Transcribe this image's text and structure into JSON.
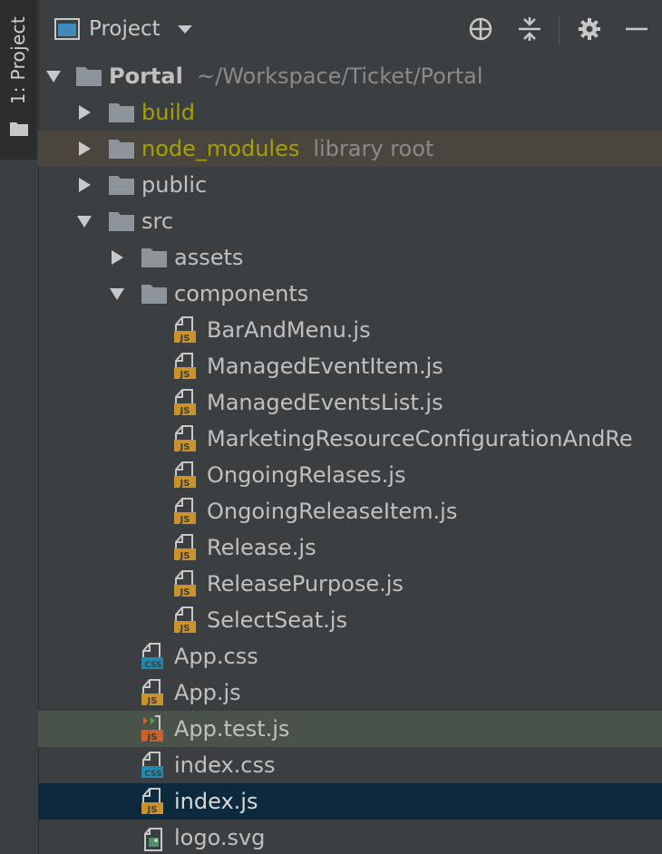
{
  "side_tab": {
    "label": "1: Project"
  },
  "toolbar": {
    "title": "Project"
  },
  "tree": {
    "root": {
      "name": "Portal",
      "path": "~/Workspace/Ticket/Portal"
    },
    "build": "build",
    "node_modules": {
      "name": "node_modules",
      "hint": "library root"
    },
    "public": "public",
    "src": "src",
    "assets": "assets",
    "components": "components",
    "component_files": [
      "BarAndMenu.js",
      "ManagedEventItem.js",
      "ManagedEventsList.js",
      "MarketingResourceConfigurationAndRe",
      "OngoingRelases.js",
      "OngoingReleaseItem.js",
      "Release.js",
      "ReleasePurpose.js",
      "SelectSeat.js"
    ],
    "src_files": [
      "App.css",
      "App.js",
      "App.test.js",
      "index.css",
      "index.js",
      "logo.svg"
    ]
  },
  "badges": {
    "js": "JS",
    "css": "CSS"
  },
  "colors": {
    "background": "#3c3f41",
    "selected": "#0d293e",
    "library_root_highlight": "#4a463d",
    "test_highlight": "#49534a",
    "excluded_folder_text": "#a6a000",
    "js_badge": "#c9922a",
    "css_badge": "#1f8bb0"
  },
  "icons": {
    "project_view": "window-icon",
    "dropdown": "chevron-down-icon",
    "locate": "crosshair-icon",
    "collapse": "collapse-all-icon",
    "settings": "gear-icon",
    "hide": "minus-icon"
  }
}
